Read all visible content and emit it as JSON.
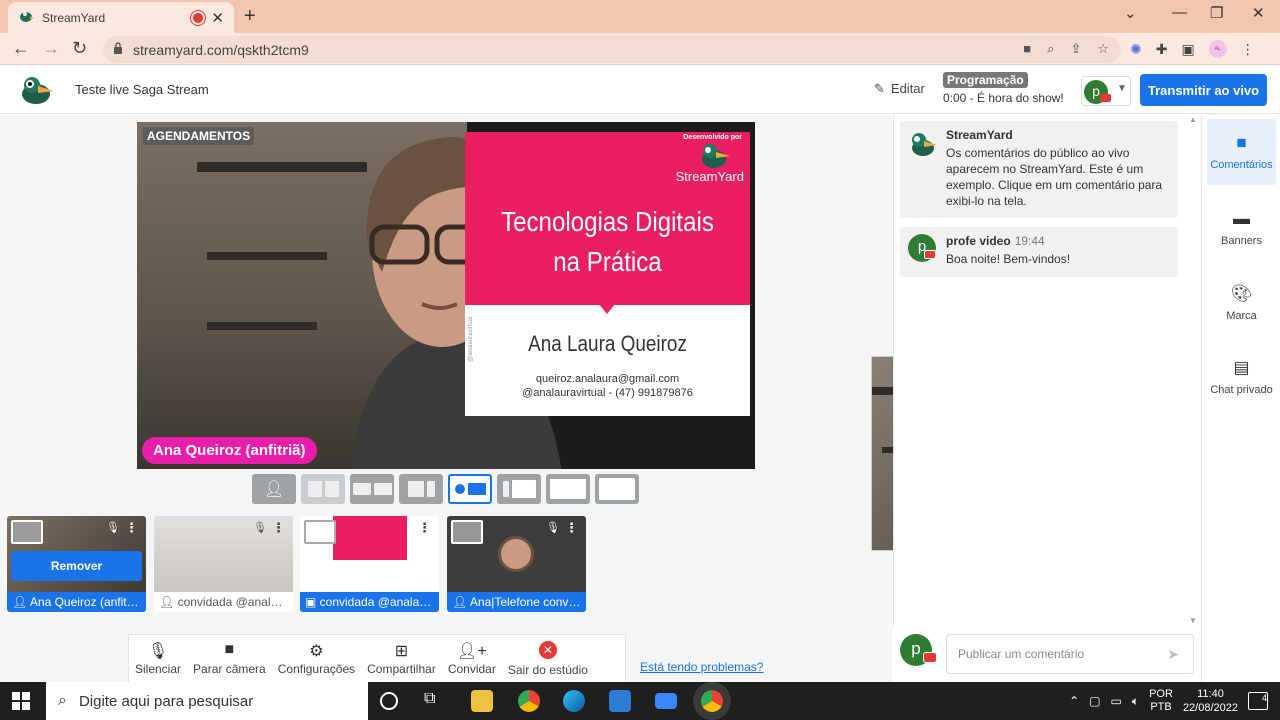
{
  "browser": {
    "tab_title": "StreamYard",
    "url": "streamyard.com/qskth2tcm9"
  },
  "header": {
    "broadcast_title": "Teste live Saga Stream",
    "edit_label": "Editar",
    "schedule_badge": "Programação",
    "schedule_text": "0:00 - É hora do show!",
    "destination_avatar_letter": "p",
    "go_live_label": "Transmitir ao vivo"
  },
  "stage": {
    "overlay_tag": "AGENDAMENTOS",
    "host_name_label": "Ana Queiroz (anfitriã)",
    "slide": {
      "developed_by": "Desenvolvido por",
      "brand": "StreamYard",
      "title_line1": "Tecnologias Digitais",
      "title_line2": "na Prática",
      "presenter": "Ana Laura Queiroz",
      "email": "queiroz.analaura@gmail.com",
      "contact": "@analauravirtual - (47) 991879876",
      "side_handle": "@analauravirtual"
    },
    "layout_count": 8,
    "active_layout_index": 4
  },
  "participants": [
    {
      "label": "Ana Queiroz (anfitriã)",
      "on_stage": true
    },
    {
      "label": "convidada @analauravirtual",
      "on_stage": false
    },
    {
      "label": "convidada @analauravirtual",
      "on_stage": true
    },
    {
      "label": "Ana|Telefone convidada",
      "on_stage": true
    }
  ],
  "remove_button_label": "Remover",
  "toolbar": {
    "mute": "Silenciar",
    "stop_camera": "Parar câmera",
    "settings": "Configurações",
    "share": "Compartilhar",
    "invite": "Convidar",
    "leave": "Sair do estúdio"
  },
  "help_link": "Está tendo problemas?",
  "comments": [
    {
      "name": "StreamYard",
      "time": "",
      "text": "Os comentários do público ao vivo aparecem no StreamYard. Este é um exemplo. Clique em um comentário para exibi-lo na tela."
    },
    {
      "name": "profe video",
      "time": "19:44",
      "text": "Boa noite! Bem-vindos!"
    }
  ],
  "composer": {
    "avatar_letter": "p",
    "placeholder": "Publicar um comentário"
  },
  "side_tabs": [
    {
      "label": "Comentários",
      "active": true
    },
    {
      "label": "Banners",
      "active": false
    },
    {
      "label": "Marca",
      "active": false
    },
    {
      "label": "Chat privado",
      "active": false
    }
  ],
  "taskbar": {
    "search_placeholder": "Digite aqui para pesquisar",
    "lang_line1": "POR",
    "lang_line2": "PTB",
    "time": "11:40",
    "date": "22/08/2022",
    "notifications": "4"
  }
}
